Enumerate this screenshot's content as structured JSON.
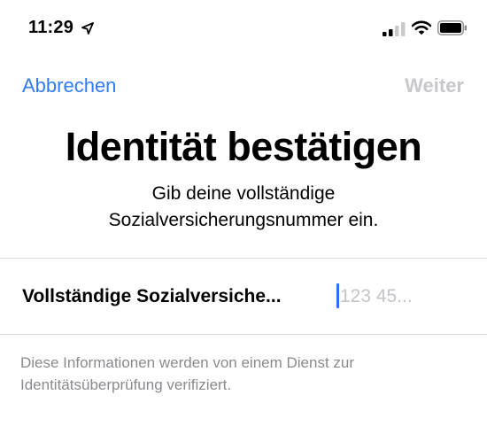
{
  "status_bar": {
    "time": "11:29",
    "icons": [
      "location-arrow-icon",
      "cellular-signal-icon",
      "wifi-icon",
      "battery-icon"
    ]
  },
  "nav": {
    "cancel_label": "Abbrechen",
    "next_label": "Weiter"
  },
  "header": {
    "title": "Identität bestätigen",
    "subtitle_line1": "Gib deine vollständige",
    "subtitle_line2": "Sozialversicherungsnummer ein."
  },
  "form": {
    "field_label": "Vollständige Sozialversiche...",
    "field_value": "",
    "field_placeholder": "123 45..."
  },
  "footer": {
    "note": "Diese Informationen werden von einem Dienst zur Identitätsüberprüfung verifiziert."
  },
  "colors": {
    "accent": "#2F7CF6",
    "disabled": "#c7c7cc",
    "secondary_text": "#8a8a8e",
    "separator": "#d9d9de"
  }
}
